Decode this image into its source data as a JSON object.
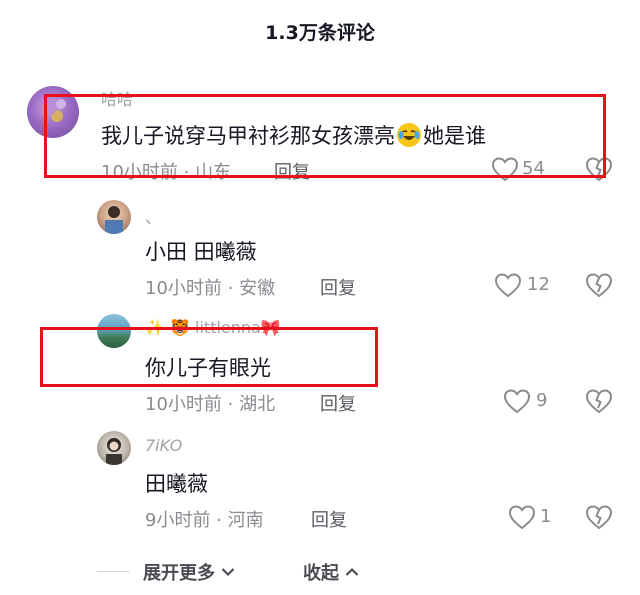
{
  "header": {
    "title": "1.3万条评论"
  },
  "comments": [
    {
      "username": "哈哈",
      "text": "我儿子说穿马甲衬衫那女孩漂亮",
      "text_suffix": "她是谁",
      "emoji": "tears-of-joy-emoji",
      "meta": "10小时前 · 山东",
      "reply_label": "回复",
      "likes": "54"
    },
    {
      "username": "、",
      "text": "小田 田曦薇",
      "meta": "10小时前 · 安徽",
      "reply_label": "回复",
      "likes": "12"
    },
    {
      "username_prefix": "✨ 🐯",
      "username": "littlenna",
      "username_suffix": "🎀",
      "text": "你儿子有眼光",
      "meta": "10小时前 · 湖北",
      "reply_label": "回复",
      "likes": "9"
    },
    {
      "username": "7iKO",
      "text": "田曦薇",
      "meta": "9小时前 · 河南",
      "reply_label": "回复",
      "likes": "1"
    }
  ],
  "footer": {
    "expand_label": "展开更多",
    "collapse_label": "收起"
  },
  "colors": {
    "highlight": "#e8101a",
    "text": "#161823",
    "muted": "#8a8b91"
  }
}
